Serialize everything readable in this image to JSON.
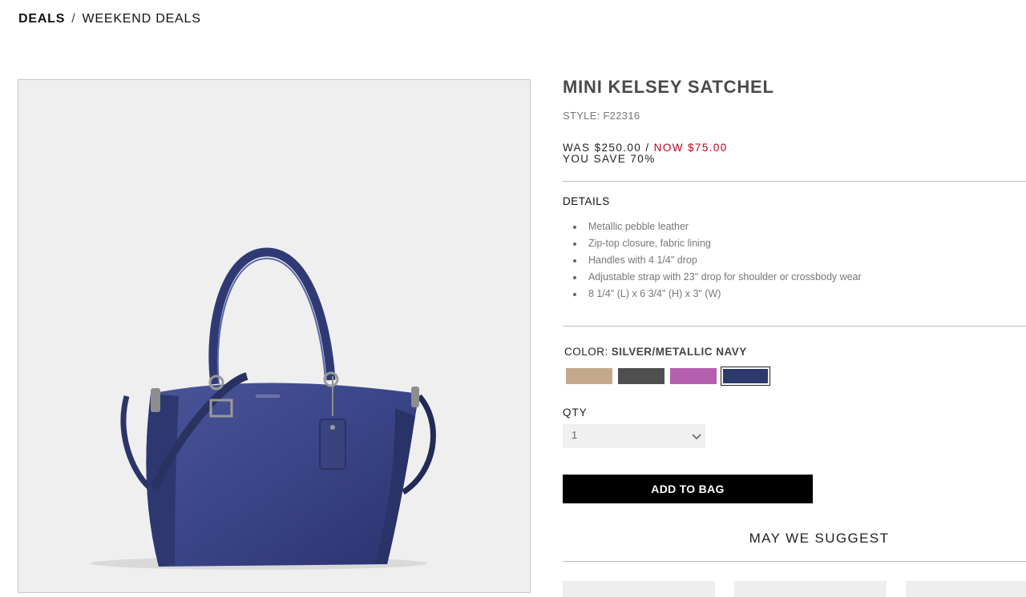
{
  "breadcrumb": {
    "home": "DEALS",
    "separator": "/",
    "current": "WEEKEND DEALS"
  },
  "product": {
    "image_alt": "Mini Kelsey Satchel in silver/metallic navy",
    "title": "MINI KELSEY SATCHEL",
    "style": "STYLE: F22316",
    "price": {
      "was": "WAS $250.00 /",
      "now": "NOW $75.00",
      "save": "YOU SAVE 70%"
    },
    "details_heading": "DETAILS",
    "details": [
      "Metallic pebble leather",
      "Zip-top closure, fabric lining",
      "Handles with 4 1/4\" drop",
      "Adjustable strap with 23\" drop for shoulder or crossbody wear",
      "8 1/4\" (L) x 6 3/4\" (H) x 3\" (W)"
    ],
    "color": {
      "label": "COLOR:",
      "selected": "SILVER/METALLIC NAVY",
      "swatches": [
        {
          "name": "tan",
          "hex": "#c4a88c"
        },
        {
          "name": "dark-gray",
          "hex": "#4f4f4f"
        },
        {
          "name": "orchid",
          "hex": "#b45fb0"
        },
        {
          "name": "navy",
          "hex": "#2c3a6b",
          "selected": true
        }
      ]
    },
    "qty": {
      "label": "QTY",
      "value": "1"
    },
    "add_to_bag": "ADD TO BAG"
  },
  "suggest": {
    "title": "MAY WE SUGGEST"
  }
}
